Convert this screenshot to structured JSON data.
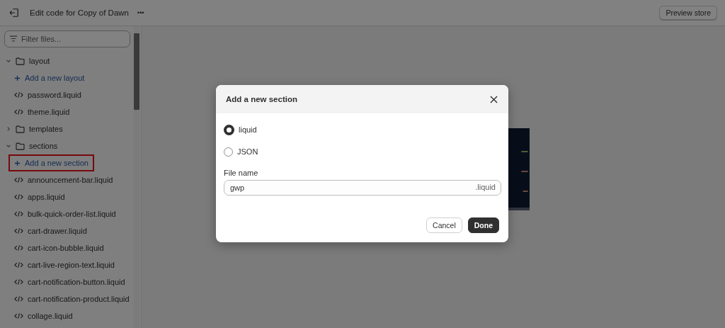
{
  "header": {
    "title": "Edit code for Copy of Dawn",
    "more": "•••",
    "preview_button": "Preview store"
  },
  "sidebar": {
    "filter": {
      "placeholder": "Filter files..."
    },
    "tree": [
      {
        "kind": "folder",
        "label": "layout",
        "expanded": true,
        "highlighted": false,
        "children": [
          {
            "kind": "add",
            "label": "Add a new layout",
            "highlighted": false
          },
          {
            "kind": "file",
            "label": "password.liquid",
            "highlighted": false
          },
          {
            "kind": "file",
            "label": "theme.liquid",
            "highlighted": false
          }
        ]
      },
      {
        "kind": "folder",
        "label": "templates",
        "expanded": false,
        "highlighted": false
      },
      {
        "kind": "folder",
        "label": "sections",
        "expanded": true,
        "highlighted": false,
        "children": [
          {
            "kind": "add",
            "label": "Add a new section",
            "highlighted": true
          },
          {
            "kind": "file",
            "label": "announcement-bar.liquid",
            "highlighted": false
          },
          {
            "kind": "file",
            "label": "apps.liquid",
            "highlighted": false
          },
          {
            "kind": "file",
            "label": "bulk-quick-order-list.liquid",
            "highlighted": false
          },
          {
            "kind": "file",
            "label": "cart-drawer.liquid",
            "highlighted": false
          },
          {
            "kind": "file",
            "label": "cart-icon-bubble.liquid",
            "highlighted": false
          },
          {
            "kind": "file",
            "label": "cart-live-region-text.liquid",
            "highlighted": false
          },
          {
            "kind": "file",
            "label": "cart-notification-button.liquid",
            "highlighted": false
          },
          {
            "kind": "file",
            "label": "cart-notification-product.liquid",
            "highlighted": false
          },
          {
            "kind": "file",
            "label": "collage.liquid",
            "highlighted": false
          }
        ]
      }
    ]
  },
  "modal": {
    "title": "Add a new section",
    "options": [
      {
        "label": "liquid",
        "selected": true
      },
      {
        "label": "JSON",
        "selected": false
      }
    ],
    "file_name": {
      "label": "File name",
      "value": "gwp",
      "suffix": ".liquid"
    },
    "buttons": [
      {
        "kind": "secondary",
        "label": "Cancel"
      },
      {
        "kind": "primary",
        "label": "Done"
      }
    ]
  }
}
